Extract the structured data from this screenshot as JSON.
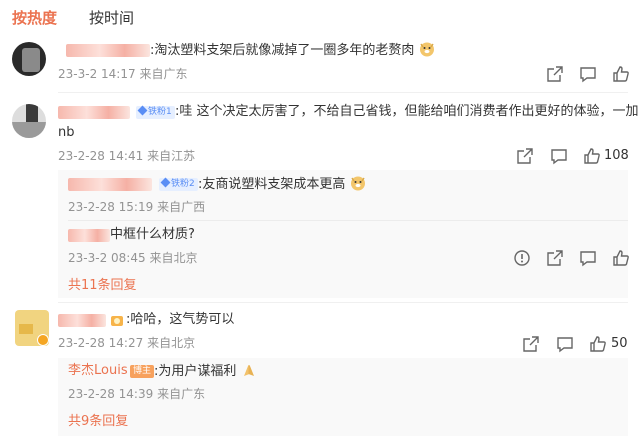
{
  "tabs": {
    "hot": "按热度",
    "time": "按时间"
  },
  "comments": [
    {
      "text": ":淘汰塑料支架后就像减掉了一圈多年的老赘肉",
      "time": "23-3-2 14:17",
      "location": "来自广东"
    },
    {
      "fan_badge": "铁粉1",
      "text_line1": ":哇 这个决定太厉害了，不给自己省钱，但能给咱们消费者作出更好的体验，一加",
      "text_line2": "nb",
      "time": "23-2-28 14:41",
      "location": "来自江苏",
      "likes": "108",
      "replies": [
        {
          "fan_badge": "铁粉2",
          "text": ":友商说塑料支架成本更高",
          "time": "23-2-28 15:19",
          "location": "来自广西"
        },
        {
          "text": "中框什么材质?",
          "time": "23-3-2 08:45",
          "location": "来自北京"
        }
      ],
      "more": "共11条回复"
    },
    {
      "text": ":哈哈，这气势可以",
      "time": "23-2-28 14:27",
      "location": "来自北京",
      "likes": "50",
      "replies": [
        {
          "author": "李杰Louis",
          "badge": "博主",
          "text": ":为用户谋福利",
          "time": "23-2-28 14:39",
          "location": "来自广东"
        }
      ],
      "more": "共9条回复"
    }
  ],
  "icons": {
    "share": "share-icon",
    "comment": "comment-icon",
    "like": "like-icon",
    "report": "report-icon"
  },
  "colors": {
    "accent": "#eb7350",
    "meta": "#939393",
    "reply_bg": "#f9f9f9"
  }
}
